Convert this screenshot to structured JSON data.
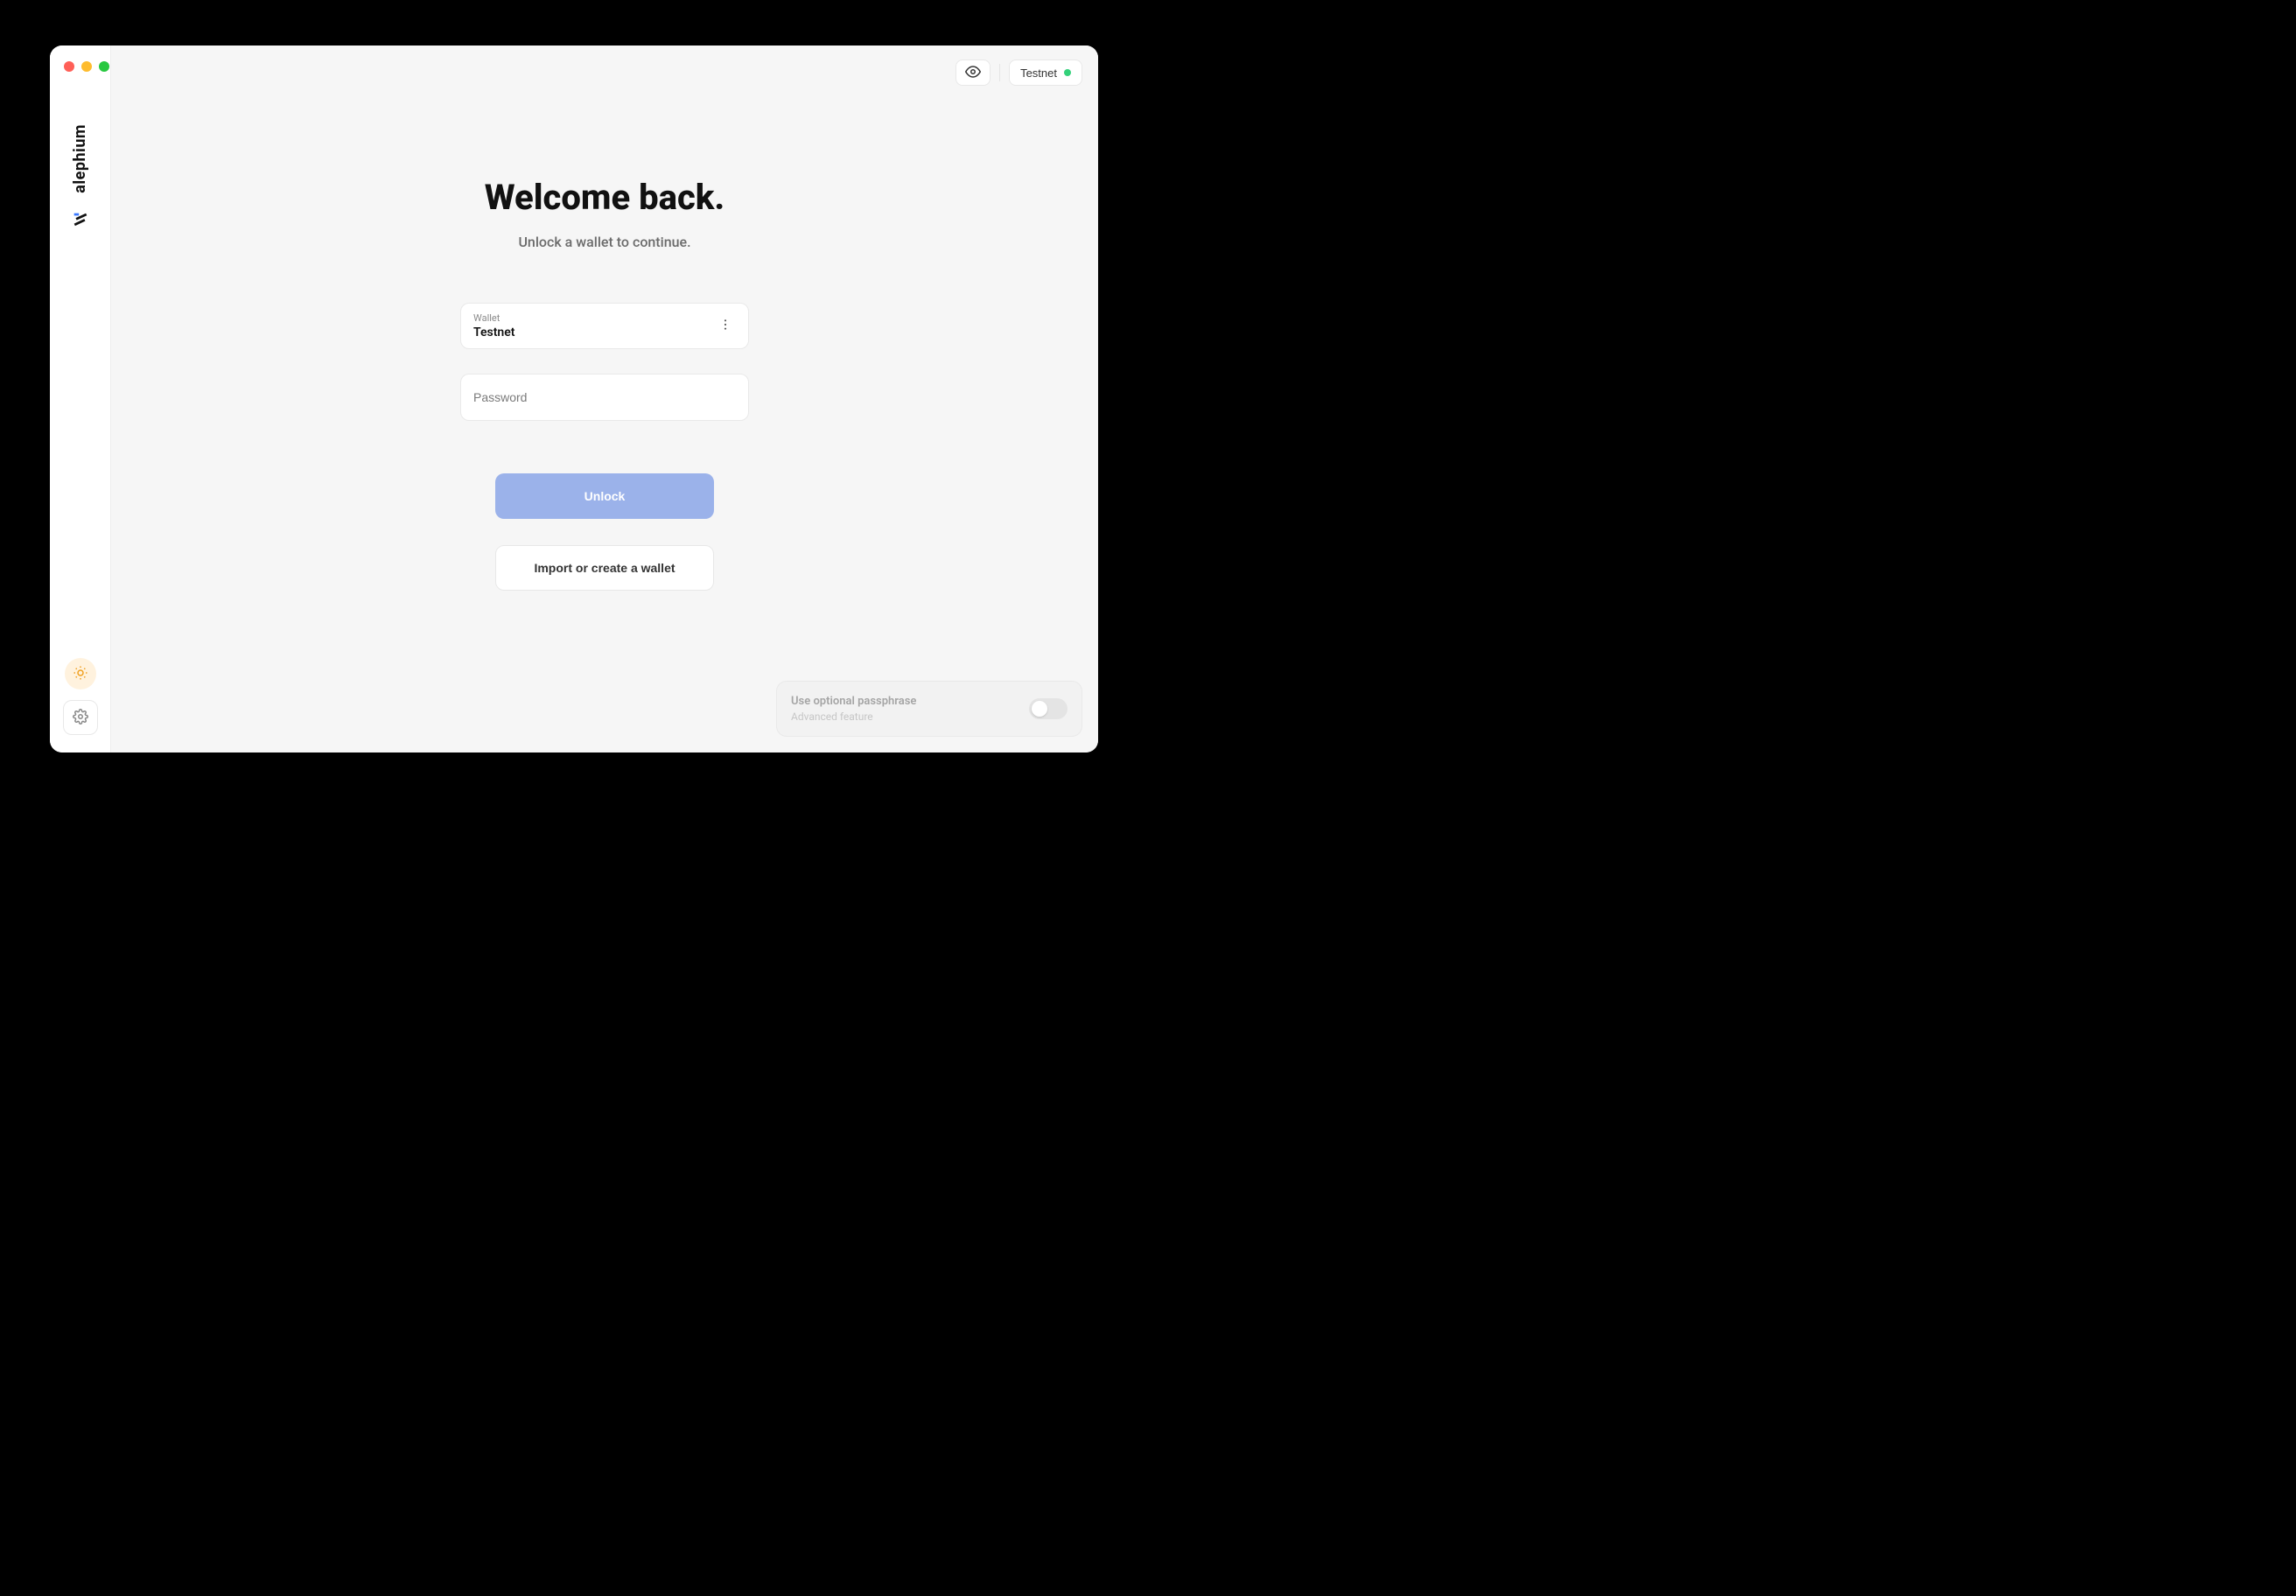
{
  "brand": {
    "name": "alephium"
  },
  "topbar": {
    "network_label": "Testnet",
    "status_color": "#33d17a"
  },
  "content": {
    "title": "Welcome back.",
    "subtitle": "Unlock a wallet to continue."
  },
  "form": {
    "wallet_label": "Wallet",
    "wallet_value": "Testnet",
    "password_placeholder": "Password"
  },
  "buttons": {
    "unlock": "Unlock",
    "import_create": "Import or create a wallet"
  },
  "passphrase": {
    "title": "Use optional passphrase",
    "subtitle": "Advanced feature"
  }
}
